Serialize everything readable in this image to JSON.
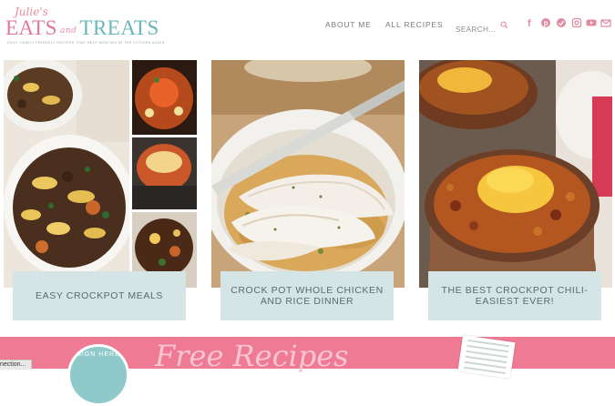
{
  "logo": {
    "script": "Julie's",
    "eats": "EATS",
    "and": "and",
    "treats": "TREATS",
    "tagline": "EASY, FAMILY FRIENDLY RECIPES THAT HELP MOM MIX IN THE KITCHEN AGAIN"
  },
  "nav": {
    "about": "ABOUT ME",
    "recipes": "ALL RECIPES",
    "search_placeholder": "SEARCH..."
  },
  "social": {
    "icons": [
      "facebook-icon",
      "pinterest-icon",
      "bloglovin-icon",
      "instagram-icon",
      "youtube-icon",
      "email-icon"
    ],
    "color": "#e38aa0"
  },
  "cards": [
    {
      "title": "EASY CROCKPOT MEALS"
    },
    {
      "title": "CROCK POT WHOLE CHICKEN AND RICE DINNER"
    },
    {
      "title": "THE BEST CROCKPOT CHILI-EASIEST EVER!"
    }
  ],
  "banner": {
    "title": "Free Recipes",
    "badge_text": "SIGN HERE"
  },
  "status_text": "nection...",
  "colors": {
    "pink": "#ee7a93",
    "teal": "#6ab7b7",
    "label_bg": "#d5e4e4"
  }
}
